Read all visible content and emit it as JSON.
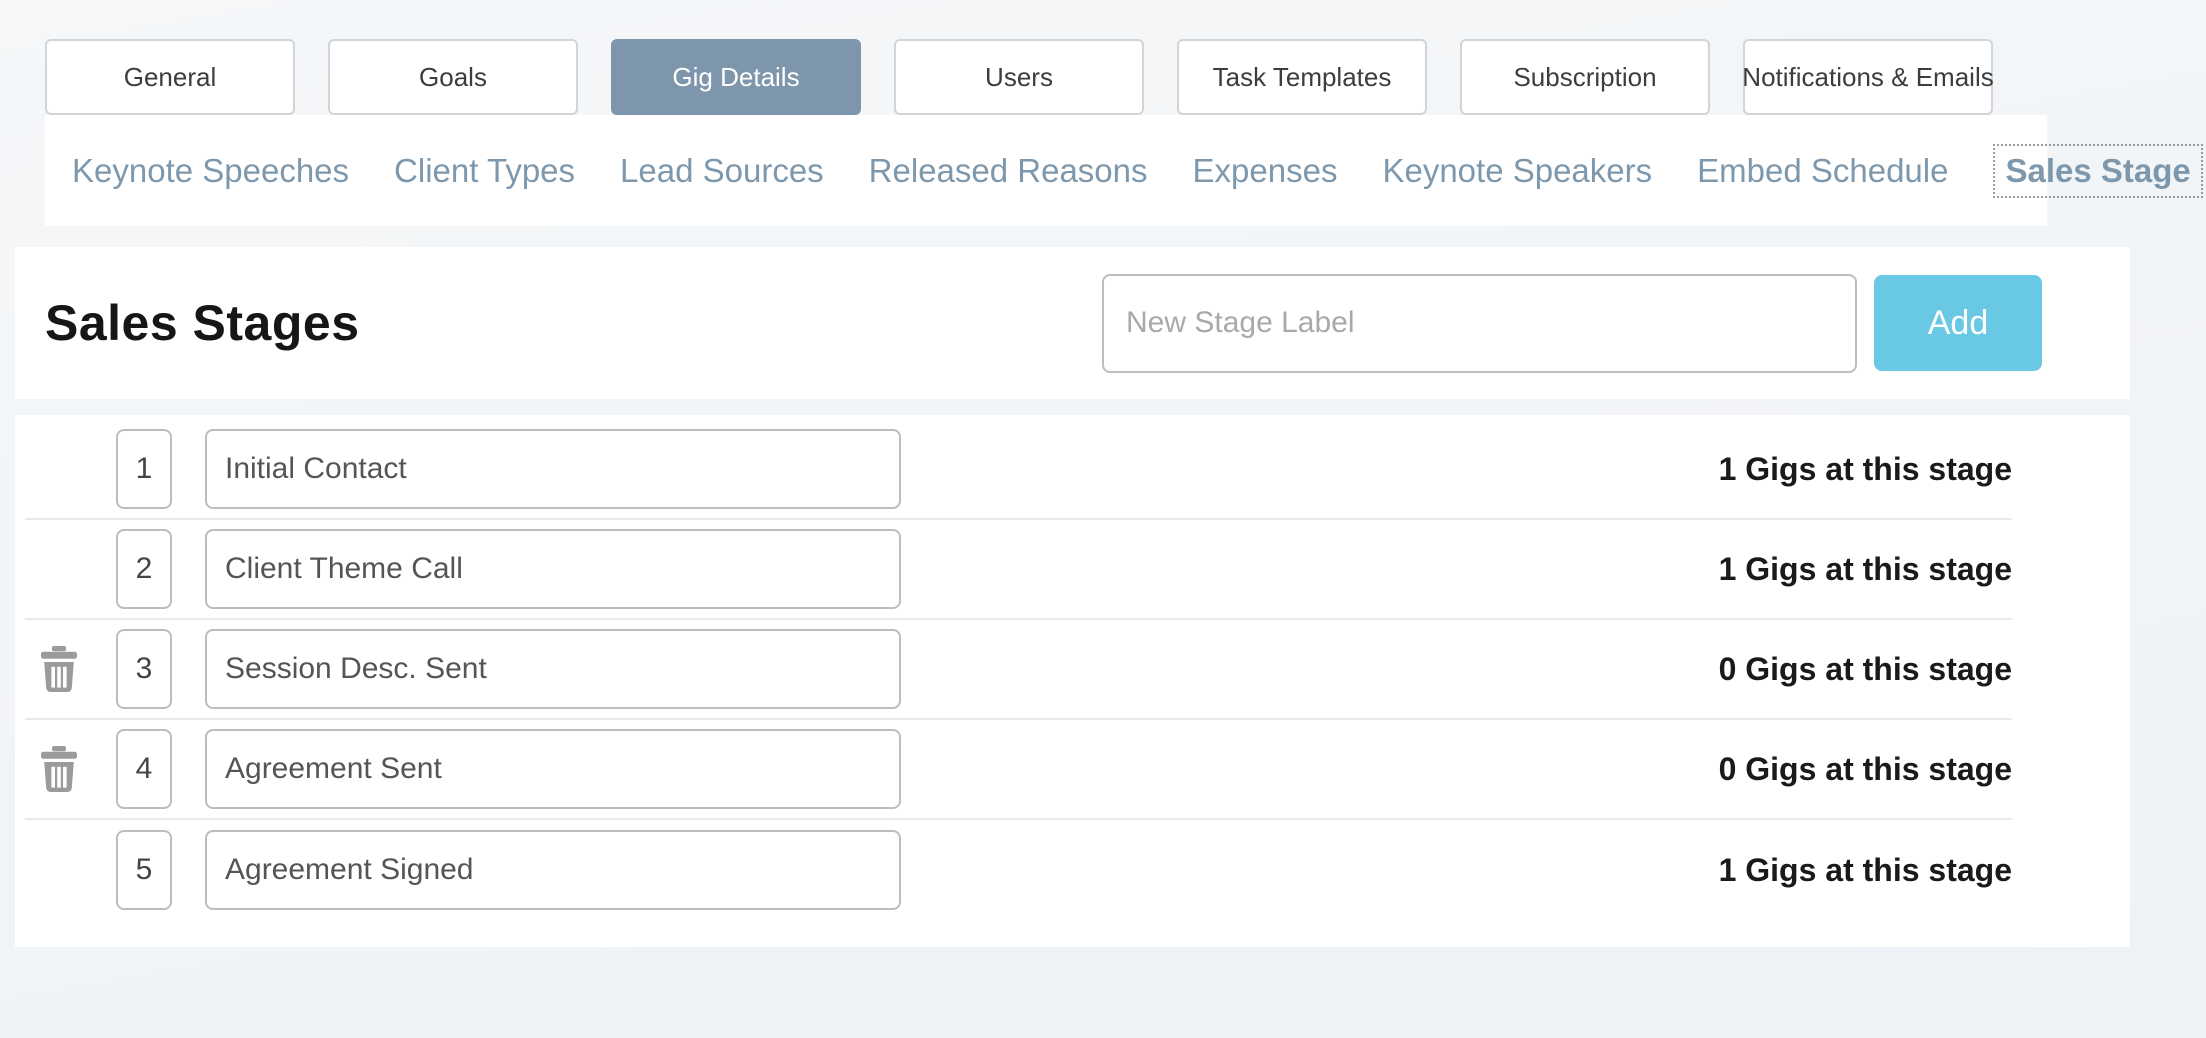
{
  "tabs": [
    {
      "label": "General",
      "active": false
    },
    {
      "label": "Goals",
      "active": false
    },
    {
      "label": "Gig Details",
      "active": true
    },
    {
      "label": "Users",
      "active": false
    },
    {
      "label": "Task Templates",
      "active": false
    },
    {
      "label": "Subscription",
      "active": false
    },
    {
      "label": "Notifications & Emails",
      "active": false
    }
  ],
  "subnav": [
    {
      "label": "Keynote Speeches",
      "active": false
    },
    {
      "label": "Client Types",
      "active": false
    },
    {
      "label": "Lead Sources",
      "active": false
    },
    {
      "label": "Released Reasons",
      "active": false
    },
    {
      "label": "Expenses",
      "active": false
    },
    {
      "label": "Keynote Speakers",
      "active": false
    },
    {
      "label": "Embed Schedule",
      "active": false
    },
    {
      "label": "Sales Stage",
      "active": true
    }
  ],
  "panel": {
    "title": "Sales Stages",
    "new_stage_placeholder": "New Stage Label",
    "add_label": "Add"
  },
  "stages": [
    {
      "order": "1",
      "label": "Initial Contact",
      "gigs": "1 Gigs at this stage",
      "deletable": false
    },
    {
      "order": "2",
      "label": "Client Theme Call",
      "gigs": "1 Gigs at this stage",
      "deletable": false
    },
    {
      "order": "3",
      "label": "Session Desc. Sent",
      "gigs": "0 Gigs at this stage",
      "deletable": true
    },
    {
      "order": "4",
      "label": "Agreement Sent",
      "gigs": "0 Gigs at this stage",
      "deletable": true
    },
    {
      "order": "5",
      "label": "Agreement Signed",
      "gigs": "1 Gigs at this stage",
      "deletable": false
    }
  ],
  "colors": {
    "active_tab": "#7d96ab",
    "subnav_link": "#7d98ad",
    "add_button": "#69c9e4",
    "trash_icon": "#9b9b9b"
  }
}
